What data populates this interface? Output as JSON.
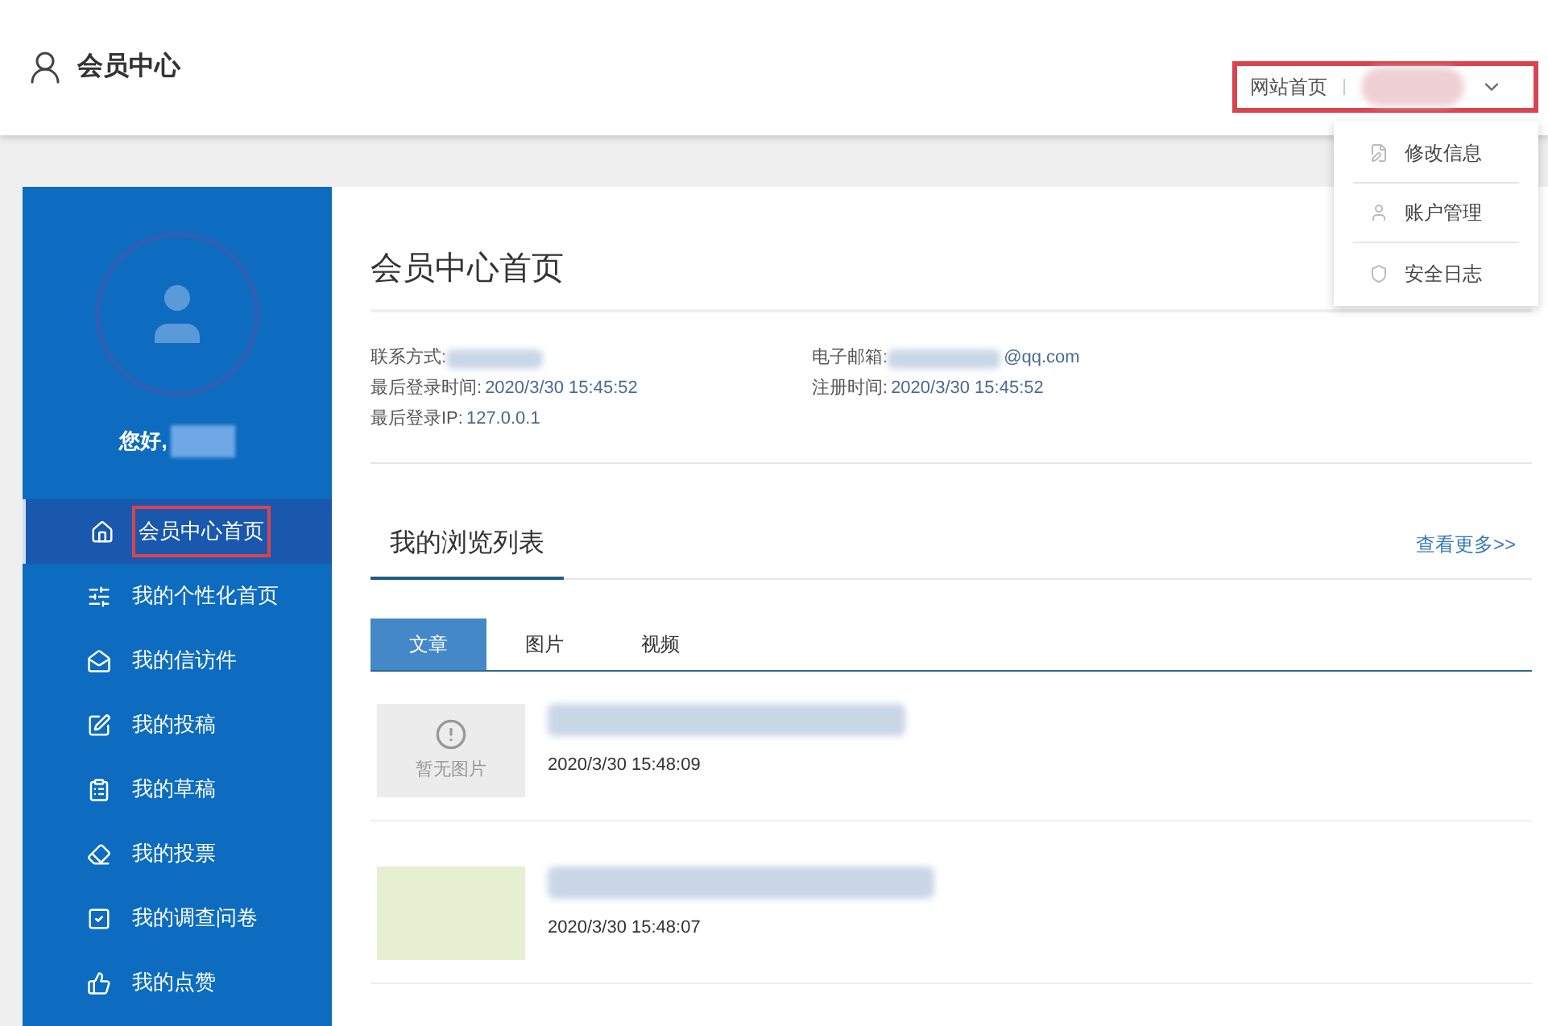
{
  "header": {
    "title": "会员中心",
    "nav_link": "网站首页"
  },
  "user_menu": {
    "expanded": true,
    "items": [
      "修改信息",
      "账户管理",
      "安全日志"
    ]
  },
  "sidebar": {
    "greeting": "您好,",
    "items": [
      {
        "label": "会员中心首页",
        "selected": true
      },
      {
        "label": "我的个性化首页",
        "selected": false
      },
      {
        "label": "我的信访件",
        "selected": false
      },
      {
        "label": "我的投稿",
        "selected": false
      },
      {
        "label": "我的草稿",
        "selected": false
      },
      {
        "label": "我的投票",
        "selected": false
      },
      {
        "label": "我的调查问卷",
        "selected": false
      },
      {
        "label": "我的点赞",
        "selected": false
      }
    ]
  },
  "main": {
    "title": "会员中心首页",
    "info": [
      {
        "label": "联系方式:"
      },
      {
        "label": "电子邮箱:",
        "value": "@qq.com"
      },
      {
        "label": "最后登录时间:",
        "value": "2020/3/30 15:45:52"
      },
      {
        "label": "注册时间:",
        "value": "2020/3/30 15:45:52"
      },
      {
        "label": "最后登录IP:",
        "value": "127.0.0.1"
      }
    ],
    "section_title": "我的浏览列表",
    "more_link": "查看更多>>",
    "tabs": [
      {
        "label": "文章",
        "selected": true
      },
      {
        "label": "图片",
        "selected": false
      },
      {
        "label": "视频",
        "selected": false
      }
    ],
    "items": [
      {
        "kind": "no-image",
        "no_image_text": "暂无图片",
        "date": "2020/3/30 15:48:09"
      },
      {
        "kind": "image",
        "date": "2020/3/30 15:48:07"
      }
    ]
  }
}
